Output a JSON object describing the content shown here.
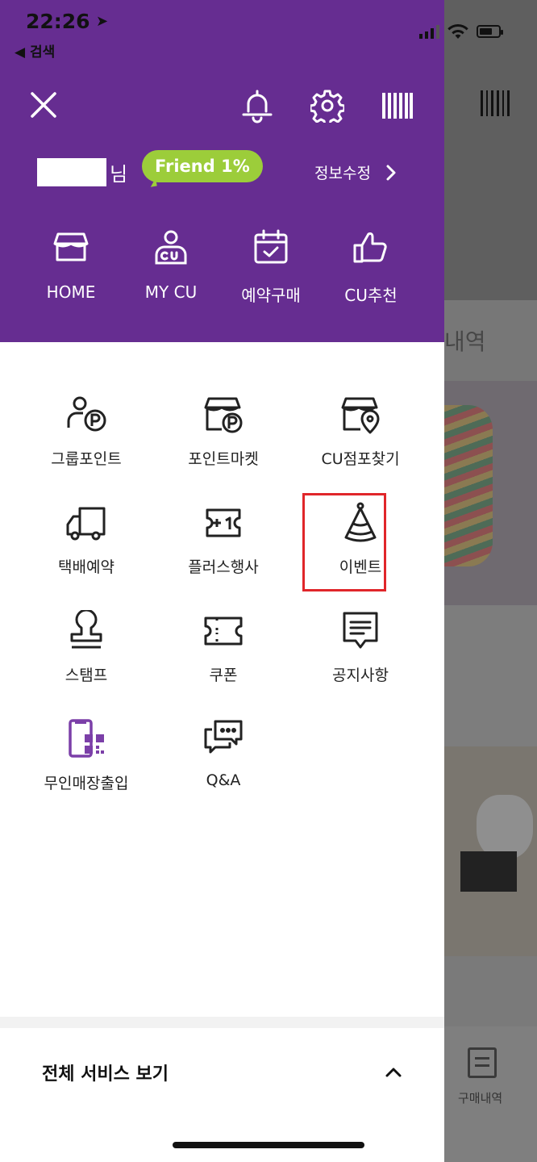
{
  "status_bar": {
    "time": "22:26",
    "location_glyph": "➤",
    "back_label": "◀ 검색"
  },
  "header": {
    "name_suffix": "님",
    "grade_badge": "Friend 1%",
    "edit_info_label": "정보수정",
    "icons": [
      "close-icon",
      "bell-icon",
      "gear-icon",
      "barcode-icon"
    ]
  },
  "quick_nav": [
    {
      "label": "HOME",
      "icon": "store-icon"
    },
    {
      "label": "MY CU",
      "icon": "user-cu-icon"
    },
    {
      "label": "예약구매",
      "icon": "calendar-check-icon"
    },
    {
      "label": "CU추천",
      "icon": "thumbs-up-icon"
    }
  ],
  "menu": [
    {
      "label": "그룹포인트",
      "icon": "group-point-icon"
    },
    {
      "label": "포인트마켓",
      "icon": "point-market-icon"
    },
    {
      "label": "CU점포찾기",
      "icon": "store-locator-icon"
    },
    {
      "label": "택배예약",
      "icon": "delivery-truck-icon"
    },
    {
      "label": "플러스행사",
      "icon": "plus-one-ticket-icon"
    },
    {
      "label": "이벤트",
      "icon": "party-hat-icon"
    },
    {
      "label": "스탬프",
      "icon": "stamp-icon"
    },
    {
      "label": "쿠폰",
      "icon": "coupon-icon"
    },
    {
      "label": "공지사항",
      "icon": "notice-icon"
    },
    {
      "label": "무인매장출입",
      "icon": "unmanned-store-qr-icon"
    },
    {
      "label": "Q&A",
      "icon": "chat-bubbles-icon"
    }
  ],
  "all_services": {
    "label": "전체 서비스 보기",
    "toggle": "chevron-up-icon"
  },
  "background": {
    "tab_text": "내역",
    "purchase_label": "구매내역"
  },
  "colors": {
    "header_purple": "#662d91",
    "badge_green": "#9ccd3a",
    "unmanned_icon_purple": "#7b3fa8",
    "highlight_red": "#e0262a"
  }
}
